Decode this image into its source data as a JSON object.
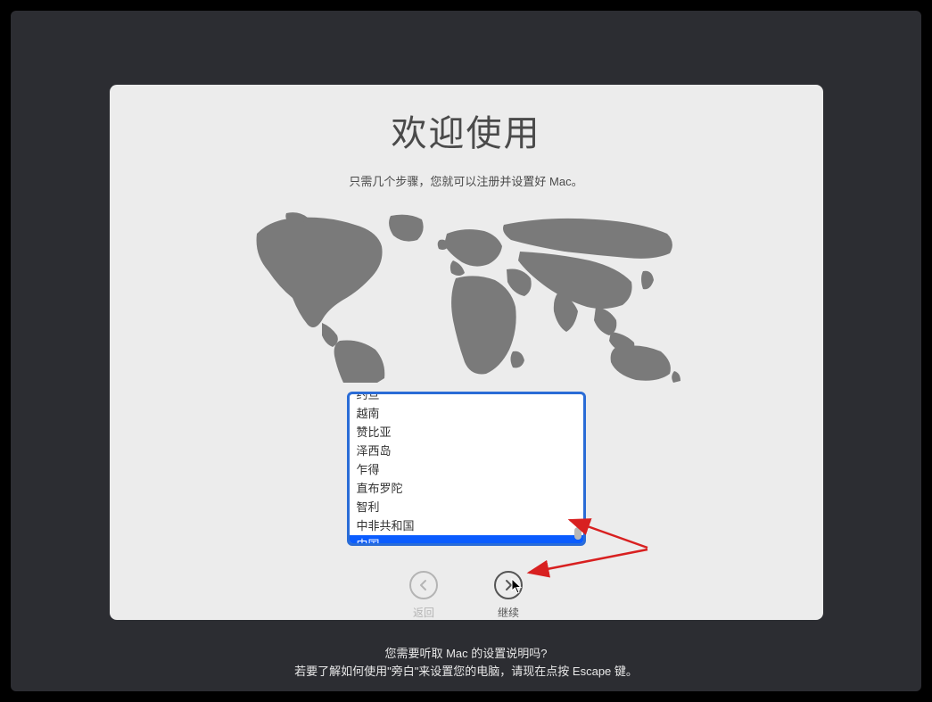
{
  "title": "欢迎使用",
  "subtitle": "只需几个步骤，您就可以注册并设置好 Mac。",
  "country_list": {
    "items": [
      {
        "label": "约旦",
        "partial": true
      },
      {
        "label": "越南"
      },
      {
        "label": "赞比亚"
      },
      {
        "label": "泽西岛"
      },
      {
        "label": "乍得"
      },
      {
        "label": "直布罗陀"
      },
      {
        "label": "智利"
      },
      {
        "label": "中非共和国"
      },
      {
        "label": "中国",
        "selected": true
      }
    ]
  },
  "buttons": {
    "back": {
      "label": "返回",
      "enabled": false
    },
    "continue": {
      "label": "继续",
      "enabled": true
    }
  },
  "footer": {
    "line1": "您需要听取 Mac 的设置说明吗?",
    "line2": "若要了解如何使用\"旁白\"来设置您的电脑，请现在点按 Escape 键。"
  },
  "colors": {
    "selection": "#0a5cff",
    "focus_ring": "#2a6cd6",
    "annotation_arrow": "#d82020"
  }
}
